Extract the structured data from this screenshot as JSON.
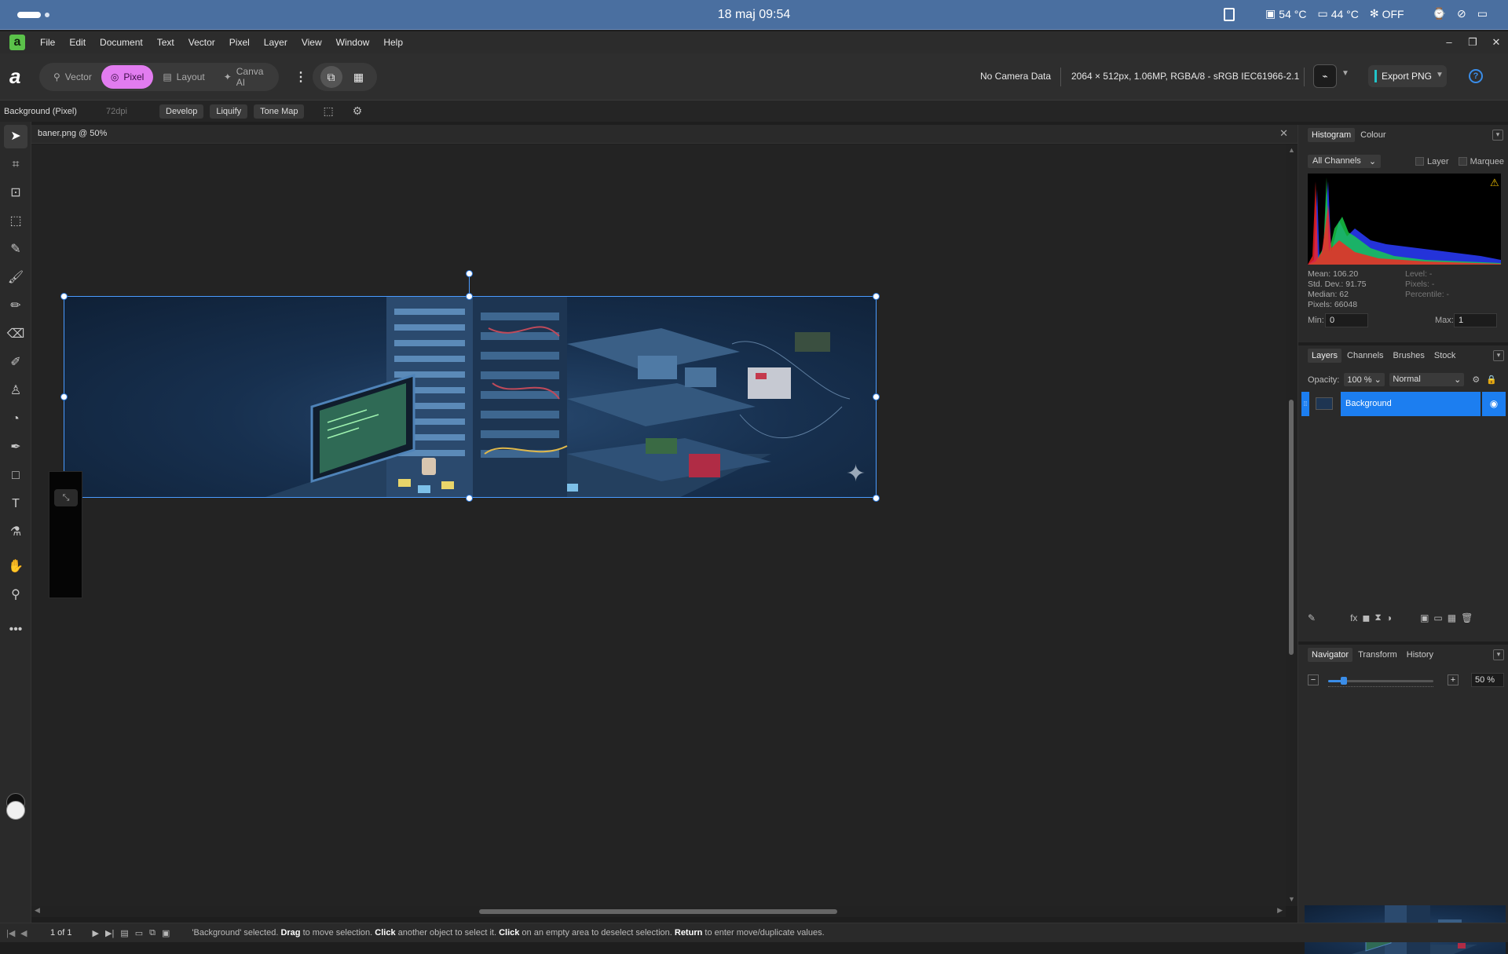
{
  "os_bar": {
    "clock": "18 maj  09:54",
    "cpu_temp": "54 °C",
    "gpu_temp": "44 °C",
    "fan_status": "OFF"
  },
  "menu": {
    "items": [
      "File",
      "Edit",
      "Document",
      "Text",
      "Vector",
      "Pixel",
      "Layer",
      "View",
      "Window",
      "Help"
    ]
  },
  "toolbar": {
    "personas": [
      {
        "label": "Vector",
        "icon": "vector-persona-icon"
      },
      {
        "label": "Pixel",
        "icon": "pixel-persona-icon"
      },
      {
        "label": "Layout",
        "icon": "layout-persona-icon"
      },
      {
        "label": "Canva AI",
        "icon": "canva-ai-icon"
      }
    ],
    "active_persona": "Pixel",
    "camera_info": "No Camera Data",
    "doc_info": "2064 × 512px, 1.06MP, RGBA/8 - sRGB IEC61966-2.1",
    "export_label": "Export PNG",
    "export_accent": "#21c3c9",
    "pixel_accent": "#e27cf0"
  },
  "context_bar": {
    "layer_label": "Background (Pixel)",
    "dpi": "72dpi",
    "buttons": [
      "Develop",
      "Liquify",
      "Tone Map"
    ]
  },
  "document": {
    "tab_title": "baner.png @ 50%"
  },
  "histogram": {
    "tabs": [
      "Histogram",
      "Colour"
    ],
    "channel": "All Channels",
    "layer_label": "Layer",
    "marquee_label": "Marquee",
    "mean": "Mean: 106.20",
    "std_dev": "Std. Dev.: 91.75",
    "median": "Median: 62",
    "pixels": "Pixels: 66048",
    "level": "Level: -",
    "pixels_r": "Pixels: -",
    "percentile": "Percentile: -",
    "min_label": "Min:",
    "min_value": "0",
    "max_label": "Max:",
    "max_value": "1"
  },
  "layers_panel": {
    "tabs": [
      "Layers",
      "Channels",
      "Brushes",
      "Stock"
    ],
    "opacity_label": "Opacity:",
    "opacity_value": "100 %",
    "blend_mode": "Normal",
    "layers": [
      {
        "name": "Background",
        "selected": true,
        "visible": true
      }
    ],
    "selection_color": "#1c7ef0"
  },
  "navigator": {
    "tabs": [
      "Navigator",
      "Transform",
      "History"
    ],
    "zoom": "50 %",
    "zoom_fraction": 0.15
  },
  "status_bar": {
    "page": "1 of 1",
    "hint_parts": [
      {
        "text": "'Background' selected. ",
        "bold": false
      },
      {
        "text": "Drag",
        "bold": true
      },
      {
        "text": " to move selection. ",
        "bold": false
      },
      {
        "text": "Click",
        "bold": true
      },
      {
        "text": " another object to select it. ",
        "bold": false
      },
      {
        "text": "Click",
        "bold": true
      },
      {
        "text": " on an empty area to deselect selection. ",
        "bold": false
      },
      {
        "text": "Return",
        "bold": true
      },
      {
        "text": " to enter move/duplicate values.",
        "bold": false
      }
    ]
  },
  "tool_icons": [
    "move-tool-icon",
    "crop-tool-icon",
    "view-tool-icon",
    "marquee-tool-icon",
    "selection-brush-icon",
    "paint-brush-icon",
    "pencil-icon",
    "erase-brush-icon",
    "retouch-brush-icon",
    "clone-stamp-icon",
    "dodge-icon",
    "pen-tool-icon",
    "rectangle-tool-icon",
    "text-tool-icon",
    "color-picker-icon",
    "hand-tool-icon",
    "zoom-tool-icon",
    "more-tools-icon"
  ]
}
